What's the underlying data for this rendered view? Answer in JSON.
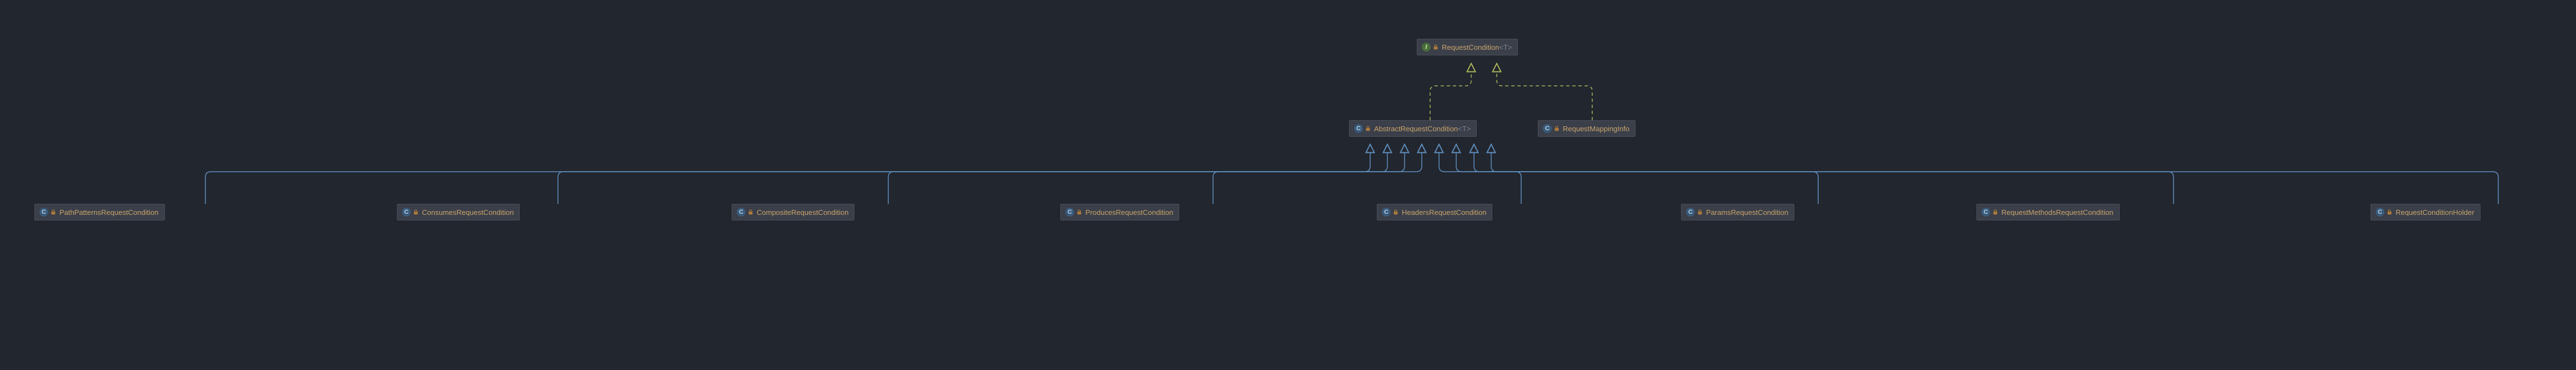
{
  "diagram": {
    "root": {
      "name": "RequestCondition",
      "generic": "<T>",
      "kind": "interface"
    },
    "mid": [
      {
        "name": "AbstractRequestCondition",
        "generic": "<T>",
        "kind": "class"
      },
      {
        "name": "RequestMappingInfo",
        "generic": "",
        "kind": "class"
      }
    ],
    "leaves": [
      {
        "name": "PathPatternsRequestCondition"
      },
      {
        "name": "ConsumesRequestCondition"
      },
      {
        "name": "CompositeRequestCondition"
      },
      {
        "name": "ProducesRequestCondition"
      },
      {
        "name": "HeadersRequestCondition"
      },
      {
        "name": "ParamsRequestCondition"
      },
      {
        "name": "RequestMethodsRequestCondition"
      },
      {
        "name": "RequestConditionHolder"
      }
    ]
  },
  "glyphs": {
    "interface": "I",
    "class": "C"
  }
}
